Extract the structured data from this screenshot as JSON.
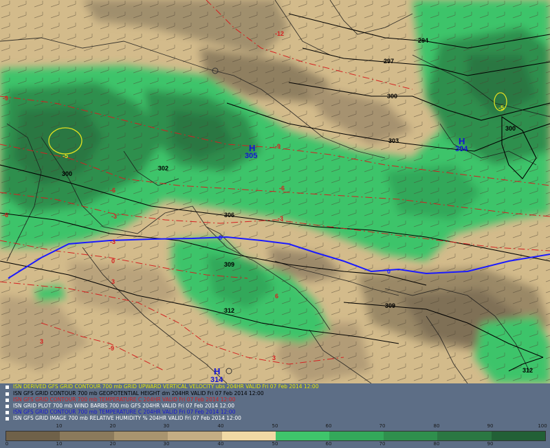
{
  "map": {
    "highs": [
      {
        "letter": "H",
        "value": "305"
      },
      {
        "letter": "H",
        "value": "304"
      },
      {
        "letter": "H",
        "value": "314"
      }
    ],
    "height_contours": [
      "294",
      "297",
      "300",
      "303",
      "306",
      "309",
      "312",
      "302",
      "300",
      "300",
      "309",
      "312"
    ],
    "temp_labels": [
      "-12",
      "-9",
      "-9",
      "-6",
      "-6",
      "-3",
      "-3",
      "-6",
      "-3",
      "0",
      "3",
      "6",
      "-9",
      "3",
      "3"
    ],
    "vv_labels": [
      "-5",
      "-5"
    ],
    "zero_label_left": "0",
    "zero_label_right": "0",
    "colors": {
      "dry": "#8b7a5c",
      "moist": "#3ec46a",
      "wet": "#2f7b45",
      "height": "#000000",
      "temperature": "#d42020",
      "zero_isotherm": "#1a1aff",
      "vertical_velocity": "#e0e020",
      "highs": "#1414d4"
    }
  },
  "legend": [
    {
      "text": "ISN DERIVED GFS GRID CONTOUR 700 mb GRID UPWARD VERTICAL VELOCITY ubs 204HR VALID Fri 07 Feb 2014 12:00",
      "color": "#e8e800"
    },
    {
      "text": "ISN GFS GRID CONTOUR 700 mb GEOPOTENTIAL HEIGHT dm 204HR VALID Fri 07 Feb 2014 12:00",
      "color": "#000000"
    },
    {
      "text": "ISN GFS GRID CONTOUR 700 mb TEMPERATURE C 204HR VALID Fri 07 Feb 2014 12:00",
      "color": "#d42020"
    },
    {
      "text": "ISN GRID PLOT 700 mb WIND BARBS 700 mb GFS 204HR VALID Fri 07 Feb 2014 12:00",
      "color": "#ffffff"
    },
    {
      "text": "ISN GFS GRID CONTOUR 700 mb TEMPERATURE C 204HR VALID Fri 07 Feb 2014 12:00",
      "color": "#1414d4"
    },
    {
      "text": "ISN GFS GRID IMAGE 700 mb RELATIVE HUMIDITY % 204HR VALID Fri 07 Feb 2014 12:00",
      "color": "#ffffff"
    }
  ],
  "colorbar": {
    "top_ticks": [
      "10",
      "20",
      "30",
      "40",
      "50",
      "60",
      "70",
      "80",
      "90",
      "100"
    ],
    "bottom_ticks": [
      "0",
      "10",
      "20",
      "30",
      "40",
      "50",
      "60",
      "70",
      "80",
      "90"
    ],
    "colors": [
      "#6f6149",
      "#8b7a5c",
      "#a8946f",
      "#c4ad84",
      "#f1d9a5",
      "#3fc56b",
      "#33a85a",
      "#2f8f4d",
      "#2b7742",
      "#226036"
    ]
  }
}
